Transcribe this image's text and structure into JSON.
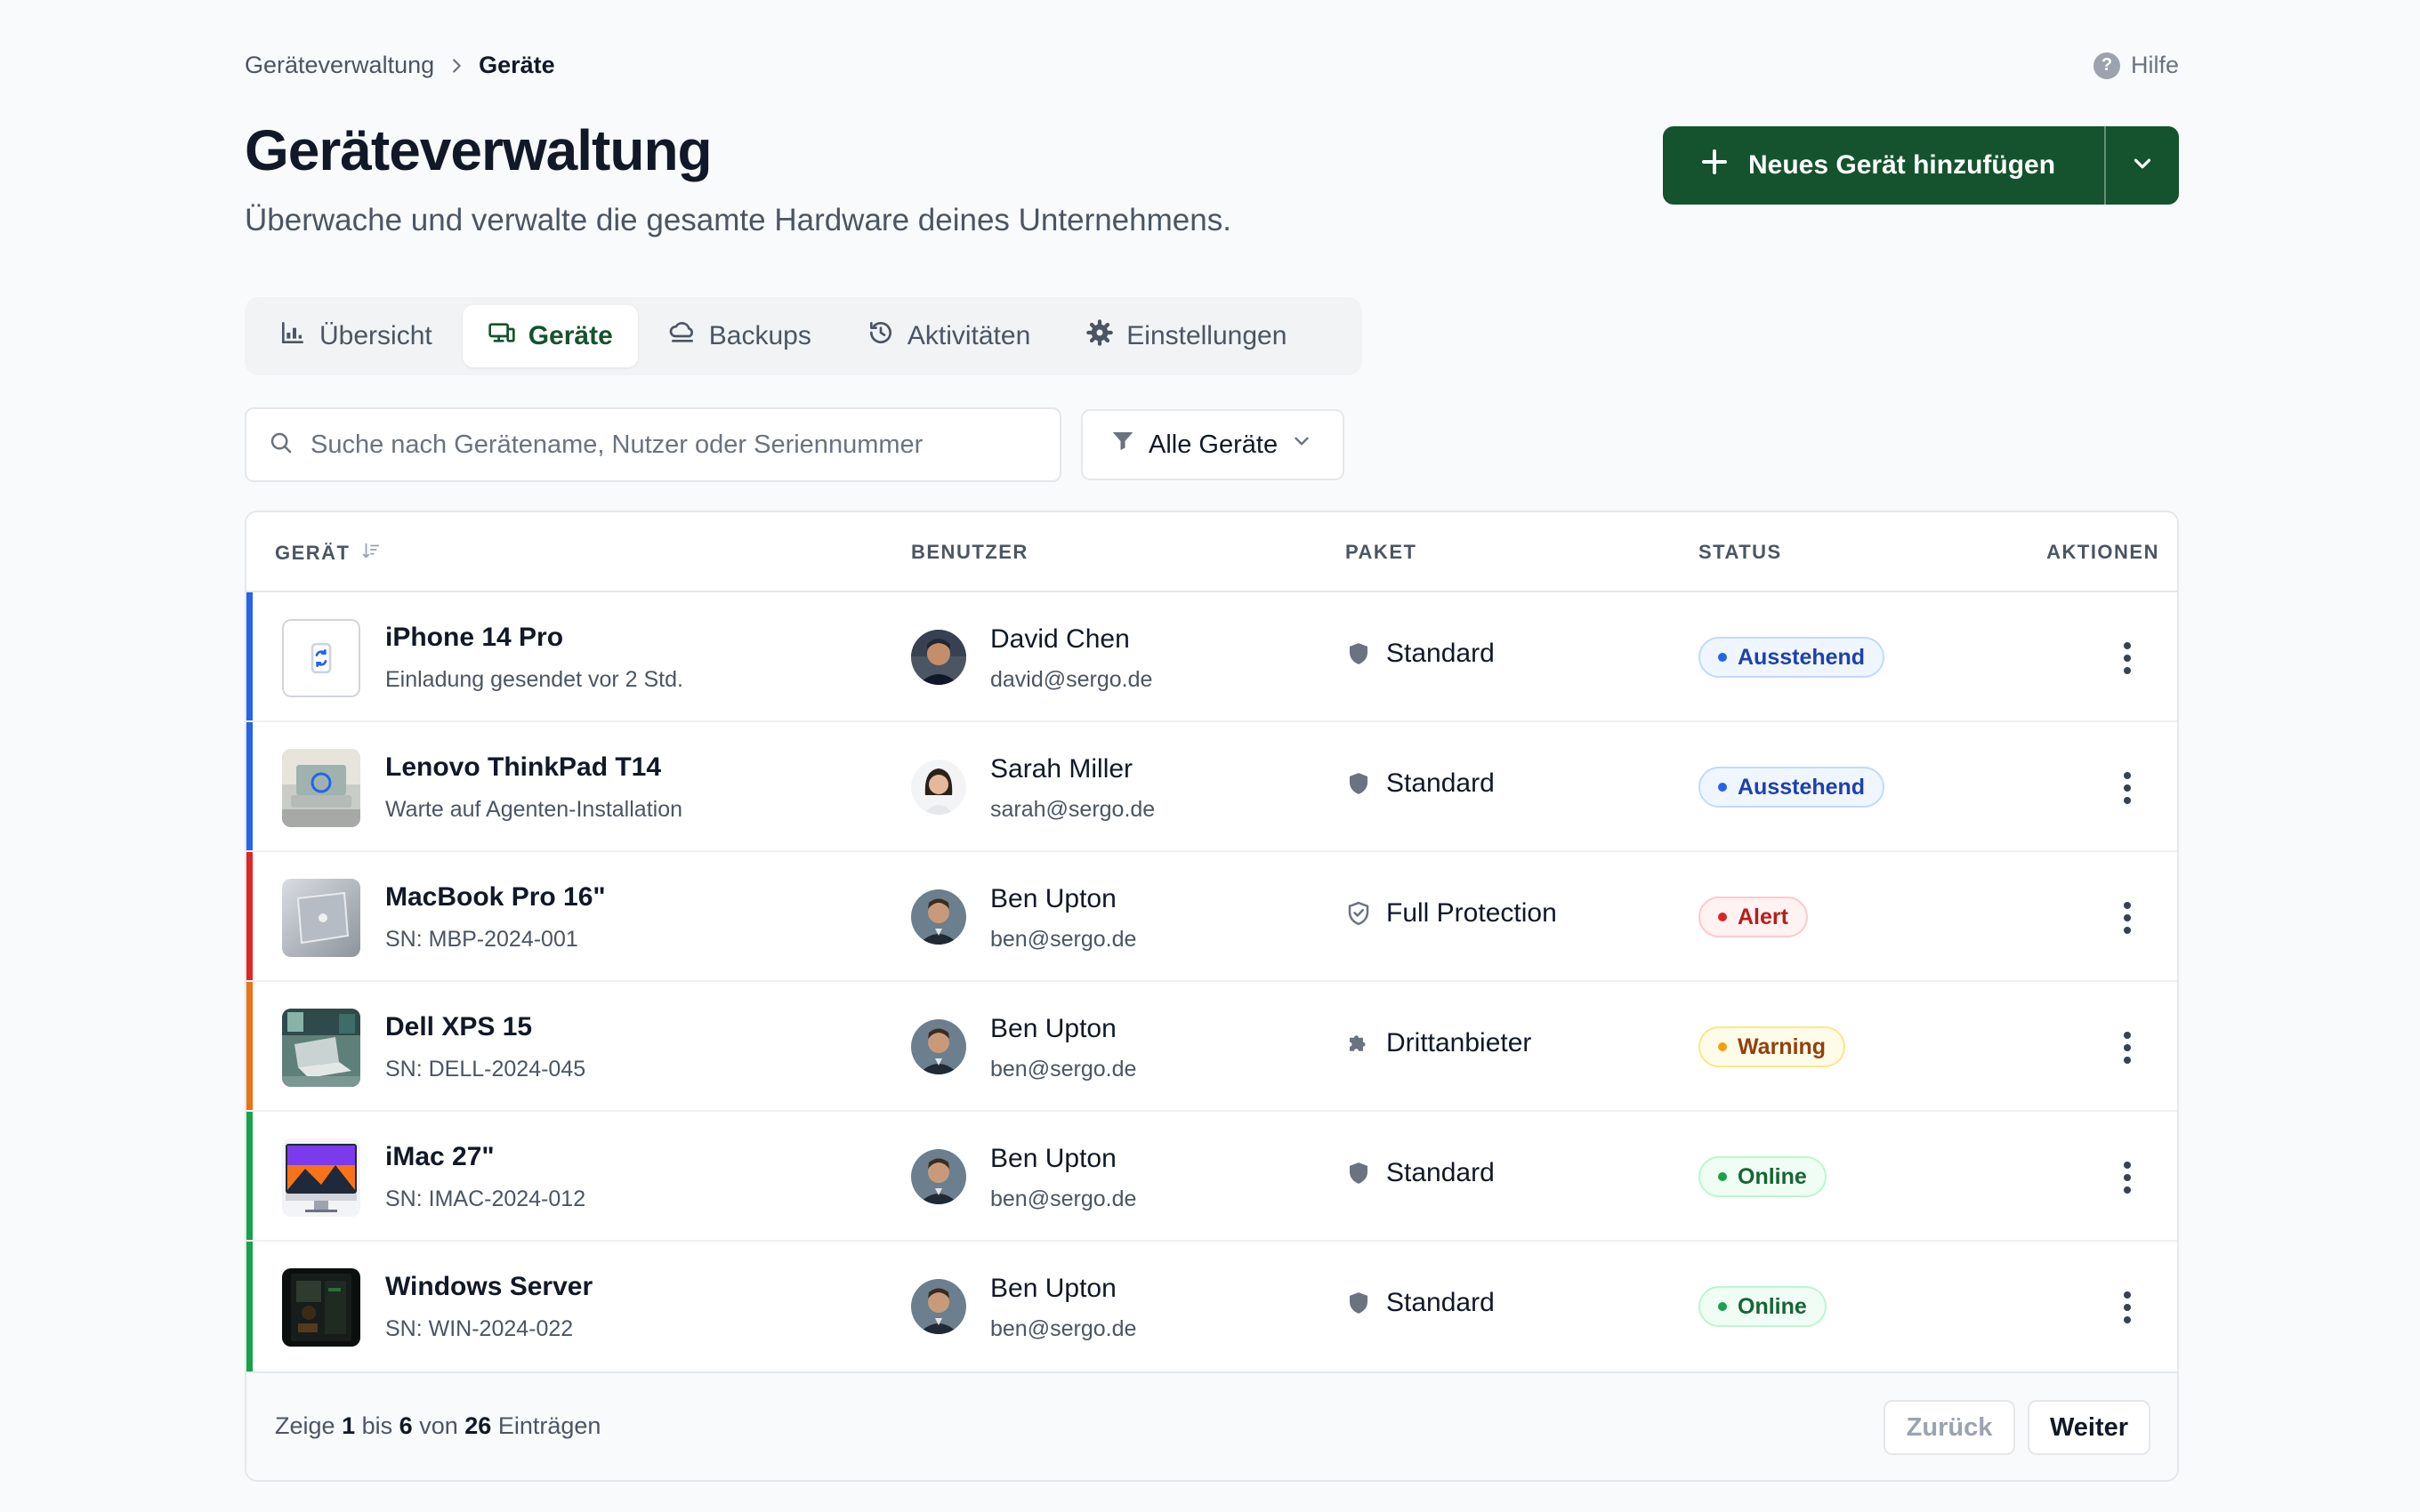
{
  "breadcrumb": {
    "parent": "Geräteverwaltung",
    "current": "Geräte"
  },
  "help": {
    "label": "Hilfe"
  },
  "header": {
    "title": "Geräteverwaltung",
    "subtitle": "Überwache und verwalte die gesamte Hardware deines Unternehmens.",
    "primary_label": "Neues Gerät hinzufügen"
  },
  "tabs": [
    {
      "label": "Übersicht",
      "icon": "chart-icon",
      "active": false
    },
    {
      "label": "Geräte",
      "icon": "devices-icon",
      "active": true
    },
    {
      "label": "Backups",
      "icon": "cloud-icon",
      "active": false
    },
    {
      "label": "Aktivitäten",
      "icon": "history-icon",
      "active": false
    },
    {
      "label": "Einstellungen",
      "icon": "gear-icon",
      "active": false
    }
  ],
  "search": {
    "placeholder": "Suche nach Gerätename, Nutzer oder Seriennummer",
    "value": ""
  },
  "filter": {
    "label": "Alle Geräte"
  },
  "table": {
    "columns": [
      "GERÄT",
      "BENUTZER",
      "PAKET",
      "STATUS",
      "AKTIONEN"
    ],
    "rows": [
      {
        "device": "iPhone 14 Pro",
        "sub": "Einladung gesendet vor 2 Std.",
        "thumb": "pending-sync",
        "user": "David Chen",
        "email": "david@sergo.de",
        "package": "Standard",
        "package_icon": "shield-icon",
        "status": "Ausstehend",
        "status_kind": "pending",
        "accent": "#2563eb"
      },
      {
        "device": "Lenovo ThinkPad T14",
        "sub": "Warte auf Agenten-Installation",
        "thumb": "laptop-pending",
        "user": "Sarah Miller",
        "email": "sarah@sergo.de",
        "package": "Standard",
        "package_icon": "shield-icon",
        "status": "Ausstehend",
        "status_kind": "pending",
        "accent": "#2563eb"
      },
      {
        "device": "MacBook Pro 16\"",
        "sub": "SN: MBP-2024-001",
        "thumb": "macbook",
        "user": "Ben Upton",
        "email": "ben@sergo.de",
        "package": "Full Protection",
        "package_icon": "shield-check-icon",
        "status": "Alert",
        "status_kind": "alert",
        "accent": "#dc2626"
      },
      {
        "device": "Dell XPS 15",
        "sub": "SN: DELL-2024-045",
        "thumb": "dell",
        "user": "Ben Upton",
        "email": "ben@sergo.de",
        "package": "Drittanbieter",
        "package_icon": "puzzle-icon",
        "status": "Warning",
        "status_kind": "warning",
        "accent": "#ea7317"
      },
      {
        "device": "iMac 27\"",
        "sub": "SN: IMAC-2024-012",
        "thumb": "imac",
        "user": "Ben Upton",
        "email": "ben@sergo.de",
        "package": "Standard",
        "package_icon": "shield-icon",
        "status": "Online",
        "status_kind": "online",
        "accent": "#16a34a"
      },
      {
        "device": "Windows Server",
        "sub": "SN: WIN-2024-022",
        "thumb": "server",
        "user": "Ben Upton",
        "email": "ben@sergo.de",
        "package": "Standard",
        "package_icon": "shield-icon",
        "status": "Online",
        "status_kind": "online",
        "accent": "#16a34a"
      }
    ]
  },
  "status_colors": {
    "pending": {
      "bg": "#eff6ff",
      "border": "#bfdbfe",
      "text": "#1e40af",
      "dot": "#2563eb"
    },
    "alert": {
      "bg": "#fef2f2",
      "border": "#fecaca",
      "text": "#b91c1c",
      "dot": "#dc2626"
    },
    "warning": {
      "bg": "#fefce8",
      "border": "#fde68a",
      "text": "#92400e",
      "dot": "#f59e0b"
    },
    "online": {
      "bg": "#f0fdf4",
      "border": "#bbf7d0",
      "text": "#166534",
      "dot": "#16a34a"
    }
  },
  "pagination": {
    "prefix": "Zeige",
    "from": "1",
    "mid1": "bis",
    "to": "6",
    "mid2": "von",
    "total": "26",
    "suffix": "Einträgen",
    "prev_label": "Zurück",
    "next_label": "Weiter"
  },
  "colors": {
    "brand": "#14532d"
  }
}
